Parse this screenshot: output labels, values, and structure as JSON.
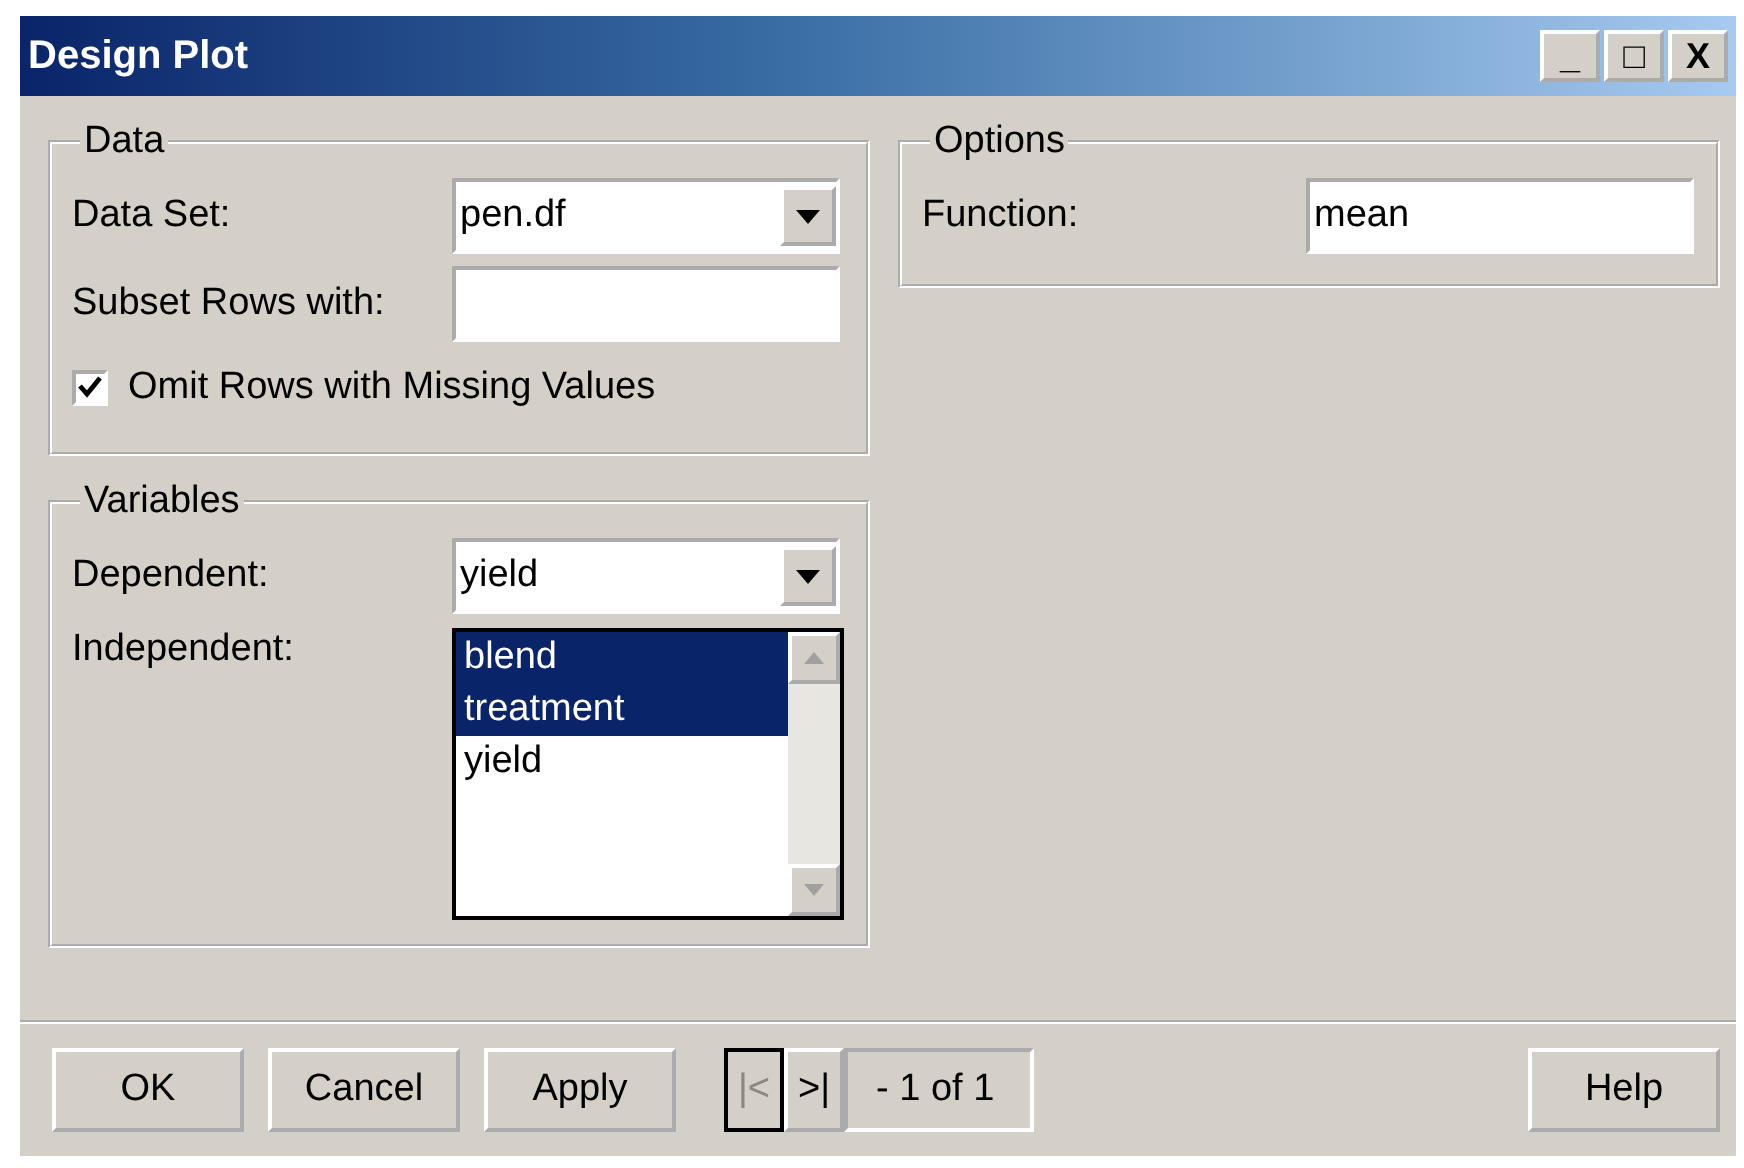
{
  "window": {
    "title": "Design Plot",
    "controls": [
      "_",
      "□",
      "X"
    ]
  },
  "data": {
    "legend": "Data",
    "data_set": {
      "label": "Data Set:",
      "value": "pen.df"
    },
    "subset": {
      "label": "Subset Rows with:"
    },
    "omit": {
      "label": "Omit Rows with Missing Values",
      "checked": true
    }
  },
  "options": {
    "legend": "Options",
    "function": {
      "label": "Function:",
      "value": "mean"
    }
  },
  "variables": {
    "legend": "Variables",
    "dependent": {
      "label": "Dependent:",
      "value": "yield"
    },
    "independent": {
      "label": "Independent:",
      "items": [
        {
          "text": "blend",
          "selected": true
        },
        {
          "text": "treatment",
          "selected": true
        },
        {
          "text": "yield",
          "selected": false
        }
      ]
    }
  },
  "footer": {
    "buttons": [
      "OK",
      "Cancel",
      "Apply"
    ],
    "pager": {
      "first": {
        "text": "|<",
        "disabled": true
      },
      "next": {
        "text": ">|",
        "disabled": false
      },
      "status": "- 1 of  1"
    },
    "help": "Help"
  }
}
